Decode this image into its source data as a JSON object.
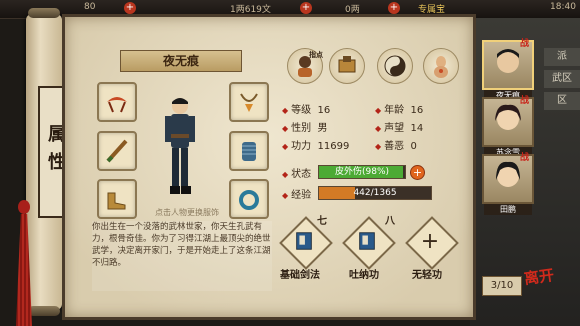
{
  "topbar": {
    "left_value": "80",
    "money": "1两619文",
    "ingot": "0两",
    "vip_label": "专属宝",
    "time": "18:40"
  },
  "right_tabs": [
    "派",
    "武区",
    "区"
  ],
  "scroll": {
    "title": "属性"
  },
  "character": {
    "name": "夜无痕",
    "hint": "点击人物更换服饰",
    "bio": "你出生在一个没落的武林世家，你天生孔武有力，根骨奇佳。你为了习得江湖上最顶尖的绝世武学，决定离开家门，于是开始走上了这条江湖不归路。"
  },
  "top_icons": [
    {
      "name": "master-icon",
      "label": "指点"
    },
    {
      "name": "scroll-icon",
      "label": ""
    },
    {
      "name": "yinyang-icon",
      "label": ""
    },
    {
      "name": "meridian-icon",
      "label": ""
    }
  ],
  "stats": {
    "level_label": "等级",
    "level": "16",
    "age_label": "年龄",
    "age": "16",
    "gender_label": "性别",
    "gender": "男",
    "fame_label": "声望",
    "fame": "14",
    "power_label": "功力",
    "power": "11699",
    "evil_label": "善恶",
    "evil": "0",
    "status_label": "状态",
    "status_text": "皮外伤(98%)",
    "status_pct": 98,
    "exp_label": "经验",
    "exp_text": "442/1365",
    "exp_pct": 32.4
  },
  "skills": [
    {
      "num": "七",
      "label": "基础剑法"
    },
    {
      "num": "八",
      "label": "吐纳功"
    },
    {
      "num": "",
      "label": "无轻功"
    }
  ],
  "pager": "3/10",
  "party": [
    {
      "name": "夜无痕",
      "tag": "战"
    },
    {
      "name": "苏念雪",
      "tag": "战"
    },
    {
      "name": "田鹏",
      "tag": "战"
    }
  ],
  "logo": "离开",
  "colors": {
    "accent_red": "#b32418",
    "status_green": "#4caa34",
    "exp_orange": "#d37a25"
  }
}
